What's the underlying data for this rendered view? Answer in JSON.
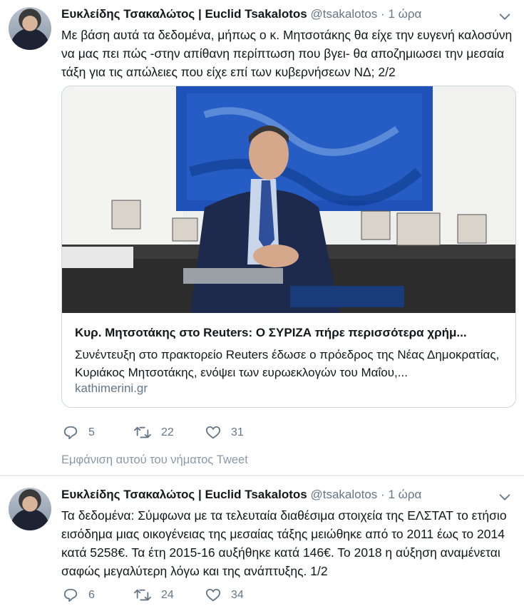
{
  "tweet1": {
    "name": "Ευκλείδης Τσακαλώτος | Euclid Tsakalotos",
    "handle": "@tsakalotos",
    "separator": "·",
    "time": "1 ώρα",
    "text": "Με βάση αυτά τα δεδομένα, μήπως ο κ. Μητσοτάκης θα είχε την ευγενή καλοσύνη να μας πει πώς -στην απίθανη περίπτωση που βγει- θα αποζημιωσει την μεσαία τάξη για τις απώλειες που είχε επί των κυβερνήσεων ΝΔ; 2/2",
    "card": {
      "title": "Κυρ. Μητσοτάκης στο Reuters: Ο ΣΥΡΙΖΑ πήρε περισσότερα χρήμ...",
      "description": "Συνέντευξη στο πρακτορείο Reuters έδωσε ο πρόεδρος της Νέας Δημοκρατίας, Κυριάκος Μητσοτάκης, ενόψει των ευρωεκλογών του Μαΐου,...",
      "domain": "kathimerini.gr"
    },
    "replies": "5",
    "retweets": "22",
    "likes": "31",
    "thread_link": "Εμφάνιση αυτού του νήματος Tweet"
  },
  "tweet2": {
    "name": "Ευκλείδης Τσακαλώτος | Euclid Tsakalotos",
    "handle": "@tsakalotos",
    "separator": "·",
    "time": "1 ώρα",
    "text": "Τα δεδομένα: Σύμφωνα με τα τελευταία διαθέσιμα στοιχεία της ΕΛΣΤΑΤ το ετήσιο εισόδημα μιας οικογένειας της μεσαίας τάξης μειώθηκε από το 2011 έως το 2014 κατά  5258€. Τα έτη 2015-16 αυξήθηκε κατά 146€. Το 2018 η αύξηση αναμένεται σαφώς μεγαλύτερη λόγω και της ανάπτυξης. 1/2",
    "replies": "6",
    "retweets": "24",
    "likes": "34"
  },
  "colors": {
    "text": "#14171a",
    "secondary": "#657786",
    "border": "#ccd6dd",
    "retweet_green": "#17bf63"
  },
  "icons": [
    "chevron-down-icon",
    "reply-icon",
    "retweet-icon",
    "like-icon"
  ]
}
